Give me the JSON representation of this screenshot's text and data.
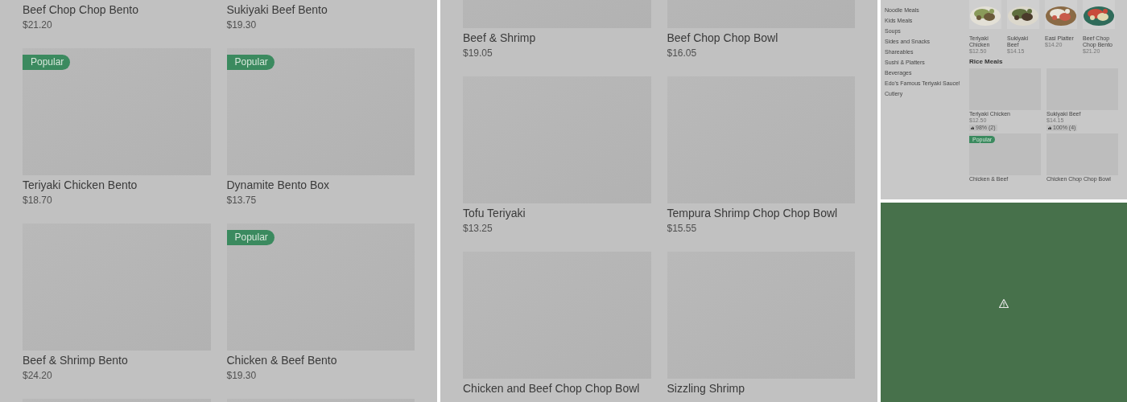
{
  "left_panel": {
    "rows": [
      {
        "items": [
          {
            "kind": "caption",
            "name": "Beef Chop Chop Bento",
            "price": "$21.20"
          },
          {
            "kind": "caption",
            "name": "Sukiyaki Beef Bento",
            "price": "$19.30"
          }
        ]
      },
      {
        "items": [
          {
            "kind": "item",
            "name": "Teriyaki Chicken Bento",
            "price": "$18.70",
            "badge": "Popular"
          },
          {
            "kind": "item",
            "name": "Dynamite Bento Box",
            "price": "$13.75",
            "badge": "Popular"
          }
        ]
      },
      {
        "items": [
          {
            "kind": "item",
            "name": "Beef & Shrimp Bento",
            "price": "$24.20"
          },
          {
            "kind": "item",
            "name": "Chicken & Beef Bento",
            "price": "$19.30",
            "badge": "Popular"
          }
        ]
      },
      {
        "items": [
          {
            "kind": "picture"
          },
          {
            "kind": "picture"
          }
        ]
      }
    ]
  },
  "middle_panel": {
    "rows": [
      {
        "items": [
          {
            "kind": "item",
            "name": "Beef & Shrimp",
            "price": "$19.05"
          },
          {
            "kind": "item",
            "name": "Beef Chop Chop Bowl",
            "price": "$16.05"
          }
        ]
      },
      {
        "items": [
          {
            "kind": "item",
            "name": "Tofu Teriyaki",
            "price": "$13.25"
          },
          {
            "kind": "item",
            "name": "Tempura Shrimp Chop Chop Bowl",
            "price": "$15.55"
          }
        ]
      },
      {
        "items": [
          {
            "kind": "item",
            "name": "Chicken and Beef Chop Chop Bowl"
          },
          {
            "kind": "item",
            "name": "Sizzling Shrimp"
          }
        ]
      }
    ]
  },
  "preview_panel": {
    "sidebar": {
      "items": [
        "Noodle Meals",
        "Kids Meals",
        "Soups",
        "Sides and Snacks",
        "Shareables",
        "Sushi & Platters",
        "Beverages",
        "Edo's Famous Teriyaki Sauce!",
        "Cutlery"
      ]
    },
    "featured": [
      {
        "name": "Teriyaki Chicken",
        "price": "$12.50"
      },
      {
        "name": "Sukiyaki Beef",
        "price": "$14.15"
      },
      {
        "name": "Easi Platter",
        "price": "$14.20"
      },
      {
        "name": "Beef Chop Chop Bento",
        "price": "$21.20"
      }
    ],
    "section_title": "Rice Meals",
    "items": [
      {
        "name": "Teriyaki Chicken",
        "price": "$12.50",
        "rating": "98% (2)"
      },
      {
        "name": "Sukiyaki Beef",
        "price": "$14.15",
        "rating": "100% (4)"
      },
      {
        "name": "Chicken & Beef",
        "badge": "Popular"
      },
      {
        "name": "Chicken Chop Chop Bowl"
      }
    ]
  },
  "error_panel": {
    "kind": "broken_image"
  }
}
